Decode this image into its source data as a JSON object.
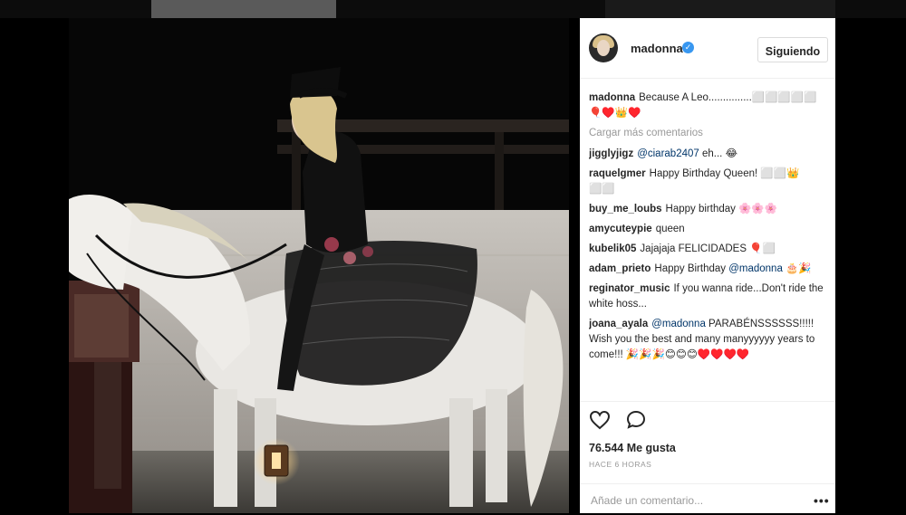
{
  "post": {
    "username": "madonna",
    "follow_label": "Siguiendo",
    "caption_text": "Because A Leo...............⬜⬜⬜⬜⬜ 🎈♥️👑♥️",
    "load_more": "Cargar más comentarios",
    "likes": "76.544 Me gusta",
    "timestamp": "HACE 6 HORAS",
    "comment_placeholder": "Añade un comentario...",
    "more_options": "•••"
  },
  "comments": [
    {
      "user": "jigglyjigz",
      "mention": "@ciarab2407",
      "text": " eh... 😂"
    },
    {
      "user": "raquelgmer",
      "mention": "",
      "text": "Happy Birthday Queen! ⬜⬜👑 ⬜⬜"
    },
    {
      "user": "buy_me_loubs",
      "mention": "",
      "text": "Happy birthday 🌸🌸🌸"
    },
    {
      "user": "amycuteypie",
      "mention": "",
      "text": "queen"
    },
    {
      "user": "kubelik05",
      "mention": "",
      "text": "Jajajaja FELICIDADES 🎈⬜"
    },
    {
      "user": "adam_prieto",
      "mention": "",
      "text": "Happy Birthday ",
      "mention_after": "@madonna",
      "text_after": " 🎂🎉"
    },
    {
      "user": "reginator_music",
      "mention": "",
      "text": "If you wanna ride...Don't ride the white hoss..."
    },
    {
      "user": "joana_ayala",
      "mention": "@madonna",
      "text": " PARABÉNSSSSSS!!!!! Wish you the best and many manyyyyyy years to come!!! 🎉🎉🎉😊😊😊♥️♥️♥️♥️"
    }
  ],
  "icons": {
    "like": "heart-icon",
    "comment": "comment-bubble-icon",
    "verified": "verified-badge-icon",
    "more": "more-options-icon"
  },
  "colors": {
    "verified": "#3897f0",
    "mention": "#003569",
    "muted": "#999999"
  }
}
